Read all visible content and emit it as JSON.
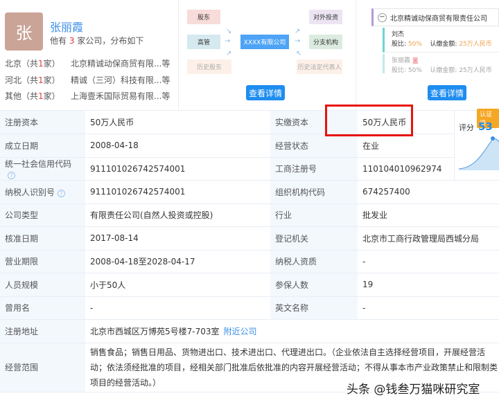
{
  "person": {
    "avatar_char": "张",
    "name": "张丽霞",
    "count_prefix": "他有",
    "count": "3",
    "count_suffix": "家公司，分布如下",
    "regions": [
      {
        "region": "北京（共",
        "n": "1",
        "unit": "家）",
        "company": "北京精诚动保商贸有限...等"
      },
      {
        "region": "河北（共",
        "n": "1",
        "unit": "家）",
        "company": "精诚（三河）科技有限...等"
      },
      {
        "region": "其他（共",
        "n": "1",
        "unit": "家）",
        "company": "上海壹禾国际贸易有限...等"
      }
    ]
  },
  "graph": {
    "shareholders": "股东",
    "executives": "高管",
    "history_shareholders": "历史股东",
    "center": "XXXX有限公司",
    "investments": "对外投资",
    "branches": "分支机构",
    "history_legal": "历史法定代表人",
    "detail_button": "查看详情"
  },
  "equity": {
    "company": "北京精诚动保商贸有限责任公司",
    "holders": [
      {
        "name": "刘杰",
        "ratio_label": "股比:",
        "ratio": "50%",
        "amount_label": "认缴金额:",
        "amount": "25万人民币"
      },
      {
        "name": "张丽霞",
        "ratio_label": "股比:",
        "ratio": "50%",
        "amount_label": "认缴金额:",
        "amount": "25万人民币"
      }
    ],
    "detail_button": "查看详情"
  },
  "score": {
    "badge": "认证得",
    "label": "评分",
    "value": "53"
  },
  "rows": [
    {
      "l": "注册资本",
      "v": "50万人民币",
      "l2": "实缴资本",
      "v2": "50万人民币"
    },
    {
      "l": "成立日期",
      "v": "2008-04-18",
      "l2": "经营状态",
      "v2": "在业"
    },
    {
      "l": "统一社会信用代码",
      "v": "911101026742574001",
      "l2": "工商注册号",
      "v2": "110104010962974"
    },
    {
      "l": "纳税人识别号",
      "v": "911101026742574001",
      "l2": "组织机构代码",
      "v2": "674257400"
    },
    {
      "l": "公司类型",
      "v": "有限责任公司(自然人投资或控股)",
      "l2": "行业",
      "v2": "批发业"
    },
    {
      "l": "核准日期",
      "v": "2017-08-14",
      "l2": "登记机关",
      "v2": "北京市工商行政管理局西城分局"
    },
    {
      "l": "营业期限",
      "v": "2008-04-18至2028-04-17",
      "l2": "纳税人资质",
      "v2": "-"
    },
    {
      "l": "人员规模",
      "v": "小于50人",
      "l2": "参保人数",
      "v2": "19"
    },
    {
      "l": "曾用名",
      "v": "-",
      "l2": "英文名称",
      "v2": "-"
    }
  ],
  "address": {
    "label": "注册地址",
    "value": "北京市西城区万博苑5号楼7-703室",
    "link": "附近公司"
  },
  "scope": {
    "label": "经营范围",
    "value": "销售食品；销售日用品、货物进出口、技术进出口、代理进出口。（企业依法自主选择经营项目，开展经营活动；依法须经批准的项目，经相关部门批准后依批准的内容开展经营活动；不得从事本市产业政策禁止和限制类项目的经营活动。）"
  },
  "watermark": "头条 @钱叁万猫咪研究室",
  "colors": {
    "accent": "#1e8df0",
    "highlight": "#e8120c",
    "label_bg": "#f3f8fd"
  }
}
